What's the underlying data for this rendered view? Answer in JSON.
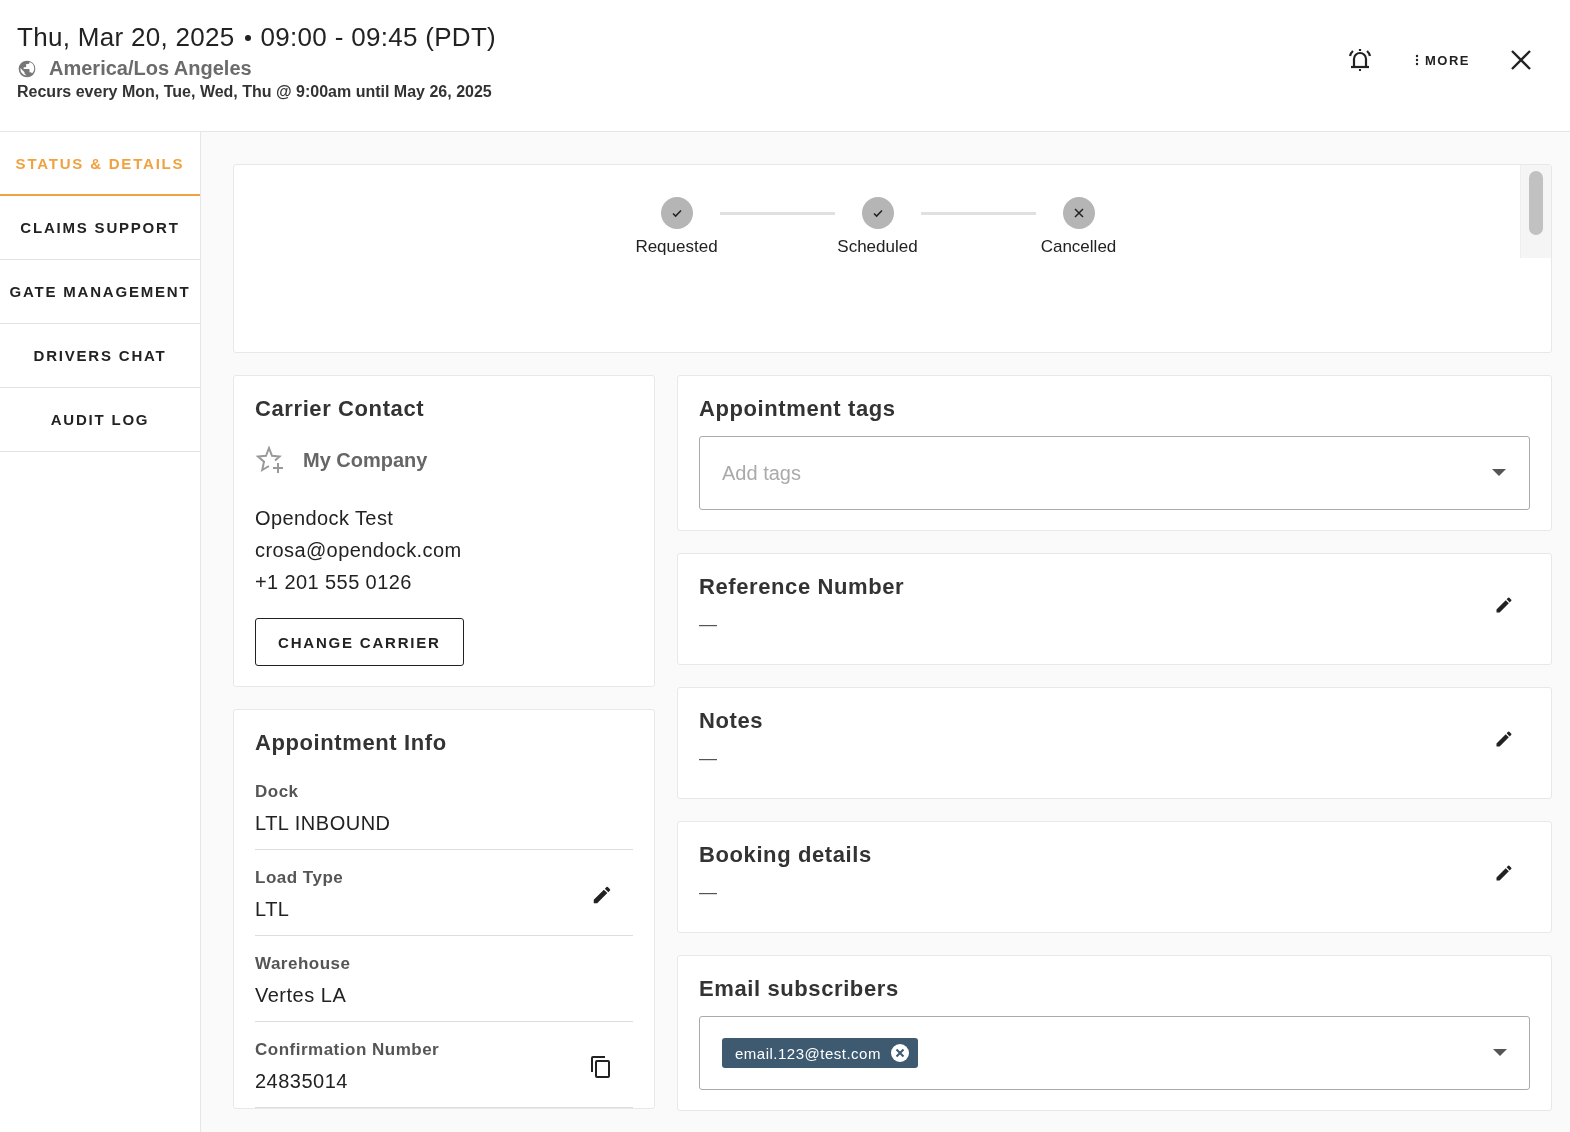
{
  "header": {
    "date": "Thu, Mar 20, 2025",
    "time": "09:00 - 09:45 (PDT)",
    "timezone": "America/Los Angeles",
    "recurrence": "Recurs every Mon, Tue, Wed, Thu @ 9:00am until May 26, 2025",
    "more_label": "MORE"
  },
  "sidebar": {
    "items": [
      {
        "label": "STATUS & DETAILS",
        "selected": true
      },
      {
        "label": "CLAIMS SUPPORT",
        "selected": false
      },
      {
        "label": "GATE MANAGEMENT",
        "selected": false
      },
      {
        "label": "DRIVERS CHAT",
        "selected": false
      },
      {
        "label": "AUDIT LOG",
        "selected": false
      }
    ]
  },
  "status": {
    "steps": [
      {
        "label": "Requested",
        "kind": "done"
      },
      {
        "label": "Scheduled",
        "kind": "done"
      },
      {
        "label": "Cancelled",
        "kind": "cancelled"
      }
    ]
  },
  "carrier_contact": {
    "title": "Carrier Contact",
    "company": "My Company",
    "name": "Opendock Test",
    "email": "crosa@opendock.com",
    "phone": "+1 201 555 0126",
    "button": "CHANGE CARRIER"
  },
  "appointment_info": {
    "title": "Appointment Info",
    "fields": [
      {
        "label": "Dock",
        "value": "LTL INBOUND",
        "kind": "plain"
      },
      {
        "label": "Load Type",
        "value": "LTL",
        "kind": "editable"
      },
      {
        "label": "Warehouse",
        "value": "Vertes LA",
        "kind": "plain"
      },
      {
        "label": "Confirmation Number",
        "value": "24835014",
        "kind": "copyable"
      }
    ]
  },
  "right_cards": [
    {
      "kind": "tags",
      "title": "Appointment tags",
      "placeholder": "Add tags"
    },
    {
      "kind": "text",
      "title": "Reference Number",
      "value": "—"
    },
    {
      "kind": "text",
      "title": "Notes",
      "value": "—"
    },
    {
      "kind": "text",
      "title": "Booking details",
      "value": "—"
    },
    {
      "kind": "chips",
      "title": "Email subscribers",
      "chips": [
        "email.123@test.com"
      ]
    }
  ]
}
